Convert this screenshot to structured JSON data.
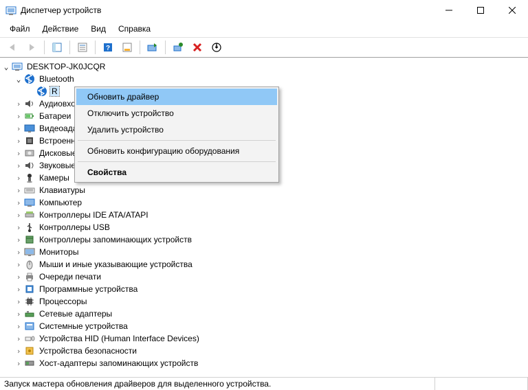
{
  "window": {
    "title": "Диспетчер устройств"
  },
  "menus": {
    "file": "Файл",
    "action": "Действие",
    "view": "Вид",
    "help": "Справка"
  },
  "tree": {
    "root": "DESKTOP-JK0JCQR",
    "bluetooth": "Bluetooth",
    "bt_adapter": "R",
    "categories": [
      "Аудиовходы и аудиовыходы",
      "Батареи",
      "Видеоадаптеры",
      "Встроенное ПО",
      "Дисковые устройства",
      "Звуковые, игровые и видеоустройства",
      "Камеры",
      "Клавиатуры",
      "Компьютер",
      "Контроллеры IDE ATA/ATAPI",
      "Контроллеры USB",
      "Контроллеры запоминающих устройств",
      "Мониторы",
      "Мыши и иные указывающие устройства",
      "Очереди печати",
      "Программные устройства",
      "Процессоры",
      "Сетевые адаптеры",
      "Системные устройства",
      "Устройства HID (Human Interface Devices)",
      "Устройства безопасности",
      "Хост-адаптеры запоминающих устройств"
    ]
  },
  "context_menu": {
    "update": "Обновить драйвер",
    "disable": "Отключить устройство",
    "uninstall": "Удалить устройство",
    "scan": "Обновить конфигурацию оборудования",
    "properties": "Свойства"
  },
  "status": "Запуск мастера обновления драйверов для выделенного устройства."
}
